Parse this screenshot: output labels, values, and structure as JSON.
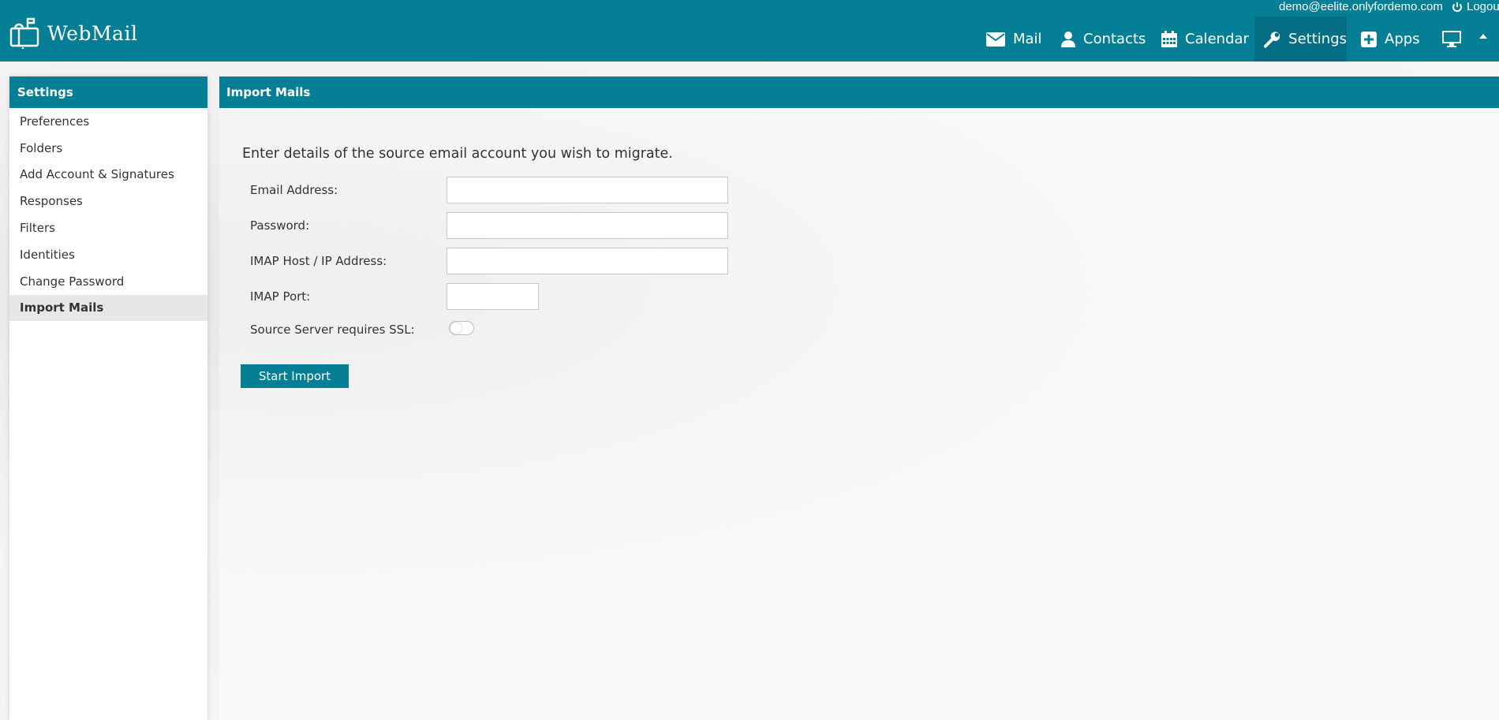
{
  "app": {
    "name": "WebMail"
  },
  "user": {
    "email": "demo@eelite.onlyfordemo.com",
    "logout_label": "Logout"
  },
  "nav": {
    "items": [
      {
        "label": "Mail",
        "icon": "envelope-icon"
      },
      {
        "label": "Contacts",
        "icon": "user-icon"
      },
      {
        "label": "Calendar",
        "icon": "calendar-icon"
      },
      {
        "label": "Settings",
        "icon": "wrench-icon",
        "active": true
      },
      {
        "label": "Apps",
        "icon": "plus-square-icon"
      }
    ],
    "extra_icon": "monitor-icon",
    "collapse_icon": "caret-up-icon"
  },
  "sidebar": {
    "title": "Settings",
    "items": [
      {
        "label": "Preferences"
      },
      {
        "label": "Folders"
      },
      {
        "label": "Add Account & Signatures"
      },
      {
        "label": "Responses"
      },
      {
        "label": "Filters"
      },
      {
        "label": "Identities"
      },
      {
        "label": "Change Password"
      },
      {
        "label": "Import Mails",
        "active": true
      }
    ]
  },
  "main": {
    "title": "Import Mails",
    "intro": "Enter details of the source email account you wish to migrate.",
    "form": {
      "email_label": "Email Address:",
      "email_value": "",
      "password_label": "Password:",
      "password_value": "",
      "host_label": "IMAP Host / IP Address:",
      "host_value": "",
      "port_label": "IMAP Port:",
      "port_value": "",
      "ssl_label": "Source Server requires SSL:",
      "ssl_enabled": false
    },
    "submit_label": "Start Import"
  },
  "colors": {
    "brand": "#057f96",
    "active_nav": "#066e84"
  }
}
